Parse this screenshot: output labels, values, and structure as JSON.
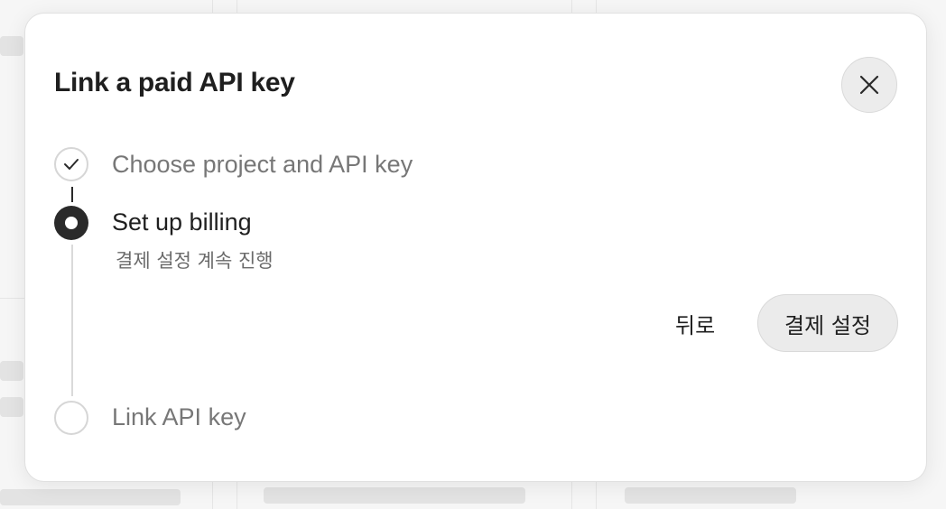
{
  "modal": {
    "title": "Link a paid API key",
    "close_icon": "close-icon"
  },
  "steps": [
    {
      "label": "Choose project and API key",
      "state": "complete",
      "icon": "check-icon"
    },
    {
      "label": "Set up billing",
      "state": "active",
      "description": "결제 설정 계속 진행"
    },
    {
      "label": "Link API key",
      "state": "pending"
    }
  ],
  "actions": {
    "back_label": "뒤로",
    "primary_label": "결제 설정"
  },
  "colors": {
    "active": "#2a2a2a",
    "muted_text": "#777777",
    "inactive_ring": "#d6d6d6",
    "button_bg": "#ebebeb"
  }
}
